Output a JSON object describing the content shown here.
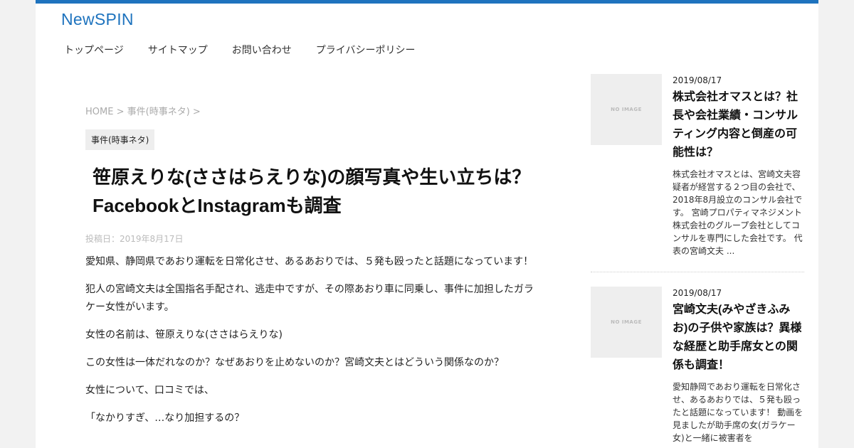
{
  "site": {
    "logo": "NewSPIN",
    "accent": "#1e73be"
  },
  "nav": [
    "トップページ",
    "サイトマップ",
    "お問い合わせ",
    "プライバシーポリシー"
  ],
  "breadcrumb": {
    "home": "HOME",
    "sep1": " > ",
    "category": "事件(時事ネタ)",
    "sep2": " >"
  },
  "article": {
    "category_tag": "事件(時事ネタ)",
    "title": "笹原えりな(ささはらえりな)の顔写真や生い立ちは？FacebookとInstagramも調査",
    "posted": "投稿日：2019年8月17日",
    "paragraphs": [
      "愛知県、静岡県であおり運転を日常化させ、あるあおりでは、５発も殴ったと話題になっています！",
      "犯人の宮崎文夫は全国指名手配され、逃走中ですが、その際あおり車に同乗し、事件に加担したガラケー女性がいます。",
      "女性の名前は、笹原えりな(ささはらえりな)",
      "この女性は一体だれなのか？なぜあおりを止めないのか？宮崎文夫とはどういう関係なのか？",
      "女性について、口コミでは、",
      "「なかりすぎ、…なり加担するの？"
    ]
  },
  "sidebar": {
    "posts": [
      {
        "thumb": "NO IMAGE",
        "date": "2019/08/17",
        "title": "株式会社オマスとは？社長や会社業績・コンサルティング内容と倒産の可能性は？",
        "excerpt": "株式会社オマスとは、宮崎文夫容疑者が経営する２つ目の会社で、2018年8月設立のコンサル会社です。 宮崎プロパティマネジメント株式会社のグループ会社としてコンサルを専門にした会社です。 代表の宮崎文夫 ..."
      },
      {
        "thumb": "NO IMAGE",
        "date": "2019/08/17",
        "title": "宮崎文夫(みやざきふみお)の子供や家族は？異様な経歴と助手席女との関係も調査！",
        "excerpt": "愛知静岡であおり運転を日常化させ、あるあおりでは、５発も殴ったと話題になっています！ 動画を見ましたが助手席の女(ガラケー女)と一緒に被害者を"
      }
    ]
  }
}
